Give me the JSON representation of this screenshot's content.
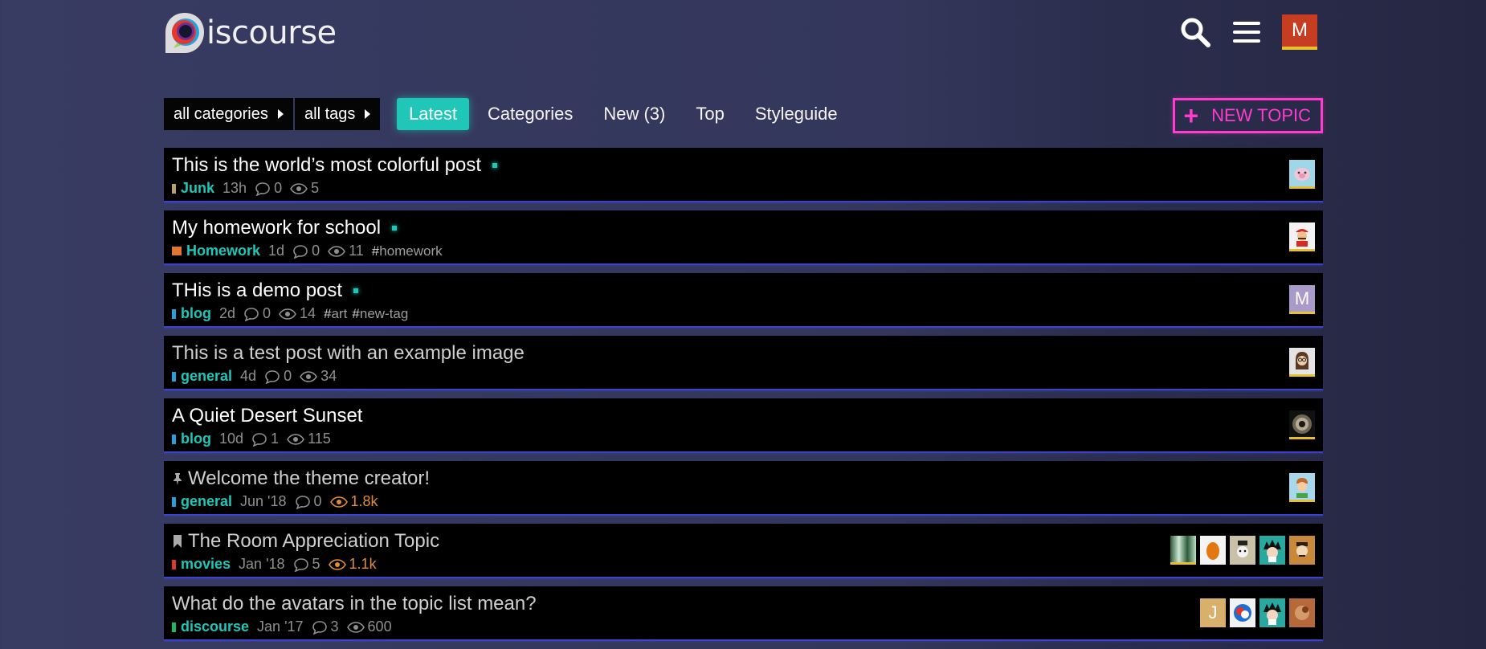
{
  "header": {
    "logo_text": "iscourse",
    "user_initial": "M",
    "icons": [
      "search-icon",
      "hamburger-menu-icon"
    ]
  },
  "nav": {
    "category_dropdown": "all categories",
    "tag_dropdown": "all tags",
    "tabs": [
      {
        "label": "Latest",
        "active": true
      },
      {
        "label": "Categories",
        "active": false
      },
      {
        "label": "New (3)",
        "active": false
      },
      {
        "label": "Top",
        "active": false
      },
      {
        "label": "Styleguide",
        "active": false
      }
    ],
    "new_topic_label": "NEW TOPIC"
  },
  "colors": {
    "accent": "#20c6b8",
    "new_topic": "#ff3bd0",
    "row_border": "#3b43c9",
    "hot_views": "#e08b3e"
  },
  "topics": [
    {
      "title": "This is the world’s most colorful post",
      "unread": true,
      "category": "Junk",
      "cat_color": "#b99e7a",
      "age": "13h",
      "replies": "0",
      "views": "5",
      "tags": []
    },
    {
      "title": "My homework for school",
      "unread": true,
      "category": "Homework",
      "cat_color": "#e0762f",
      "age": "1d",
      "replies": "0",
      "views": "11",
      "tags": [
        "homework"
      ]
    },
    {
      "title": "THis is a demo post",
      "unread": true,
      "category": "blog",
      "cat_color": "#2a9ed9",
      "age": "2d",
      "replies": "0",
      "views": "14",
      "tags": [
        "art",
        "new-tag"
      ]
    },
    {
      "title": "This is a test post with an example image",
      "unread": false,
      "category": "general",
      "cat_color": "#2a9ed9",
      "age": "4d",
      "replies": "0",
      "views": "34",
      "tags": []
    },
    {
      "title": "A Quiet Desert Sunset",
      "unread": false,
      "category": "blog",
      "cat_color": "#2a9ed9",
      "age": "10d",
      "replies": "1",
      "views": "115",
      "tags": []
    },
    {
      "title": "Welcome the theme creator!",
      "unread": false,
      "category": "general",
      "cat_color": "#2a9ed9",
      "age": "Jun '18",
      "replies": "0",
      "views": "1.8k",
      "tags": []
    },
    {
      "title": "The Room Appreciation Topic",
      "unread": false,
      "category": "movies",
      "cat_color": "#d63b2e",
      "age": "Jan '18",
      "replies": "5",
      "views": "1.1k",
      "tags": []
    },
    {
      "title": "What do the avatars in the topic list mean?",
      "unread": false,
      "category": "discourse",
      "cat_color": "#1fb85a",
      "age": "Jan '17",
      "replies": "3",
      "views": "600",
      "tags": []
    }
  ],
  "poster_letters": {
    "m_avatar": "M",
    "j_avatar": "J"
  }
}
